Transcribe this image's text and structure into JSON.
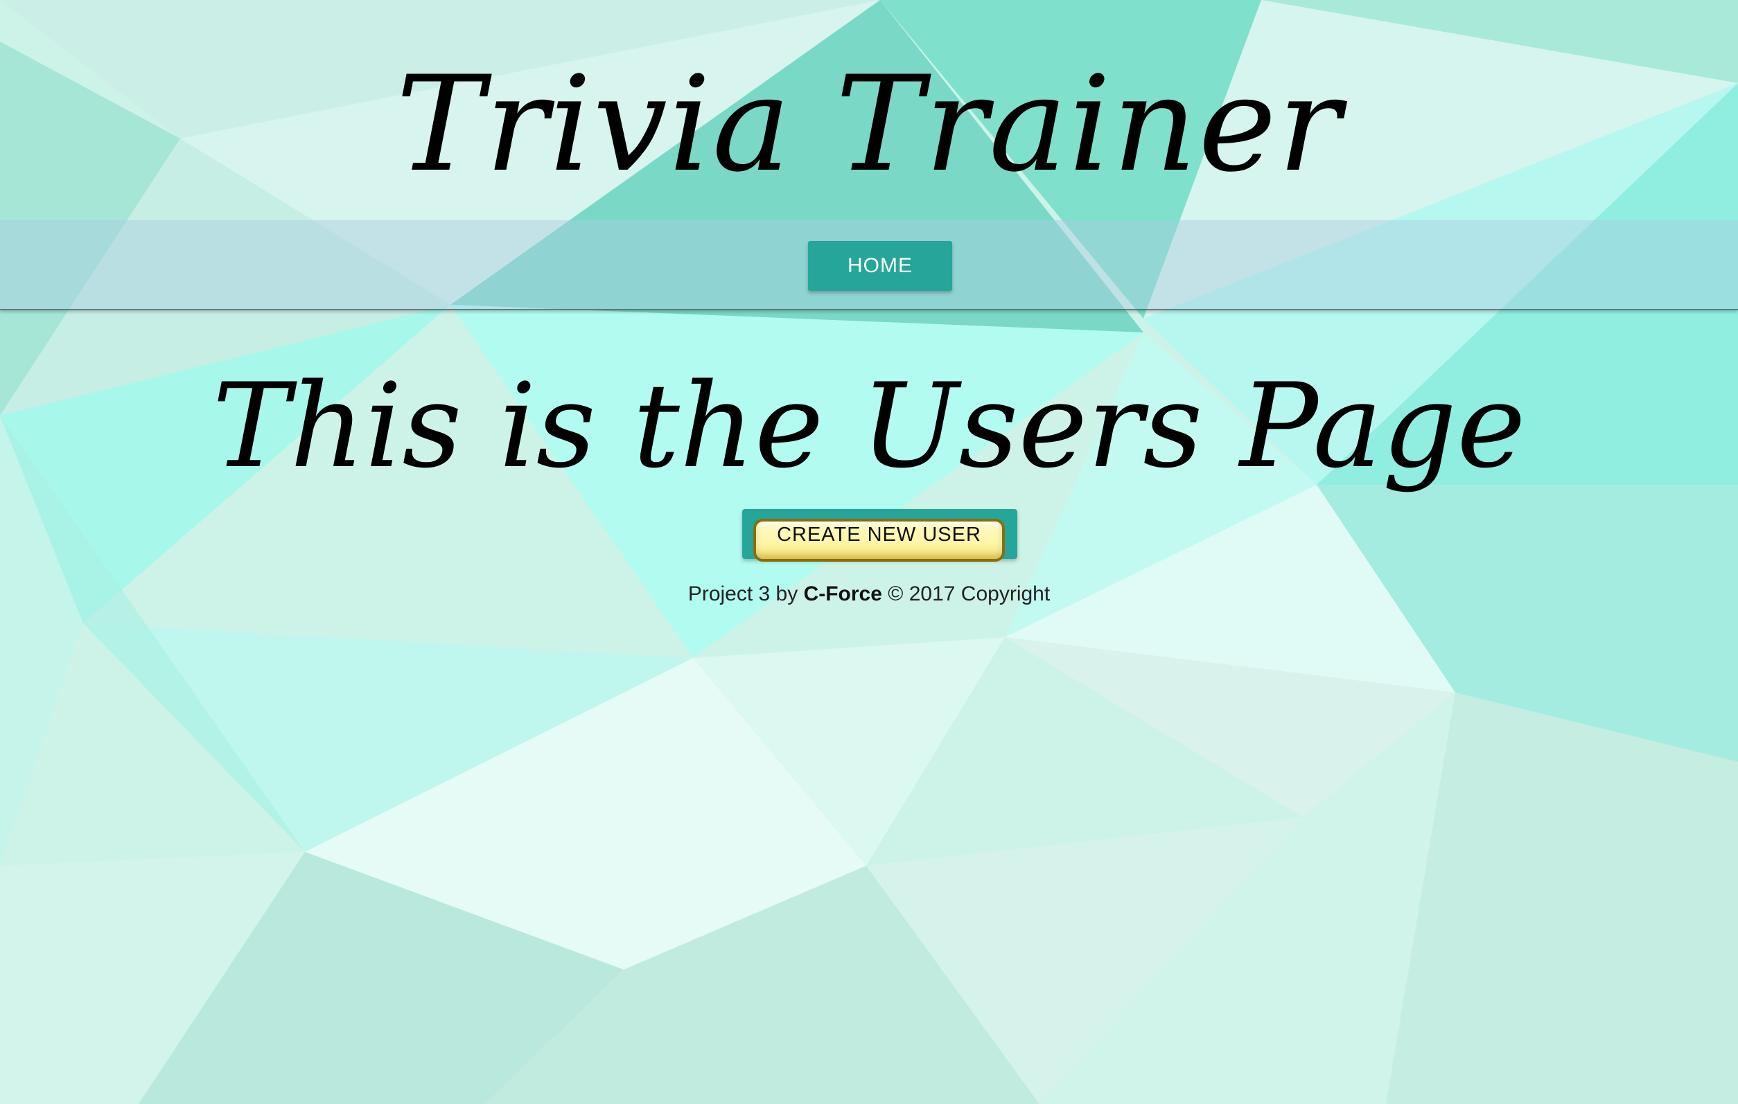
{
  "header": {
    "site_title": "Trivia Trainer"
  },
  "navbar": {
    "home_label": "HOME"
  },
  "main": {
    "heading": "This is the Users Page",
    "create_button_label": "CREATE NEW USER"
  },
  "footer": {
    "prefix": "Project 3 by",
    "author": "C-Force",
    "suffix": "© 2017 Copyright"
  },
  "colors": {
    "accent": "#26a69a",
    "button_yellow": "#fff6a8"
  }
}
